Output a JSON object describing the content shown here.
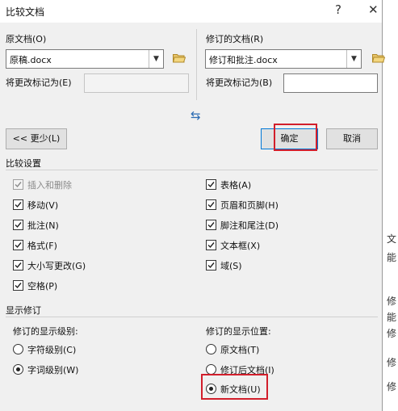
{
  "dialog": {
    "title": "比较文档",
    "help_icon": "?",
    "close_icon": "✕"
  },
  "original": {
    "label": "原文档(O)",
    "value": "原稿.docx",
    "mark_label": "将更改标记为(E)",
    "mark_value": ""
  },
  "revised": {
    "label": "修订的文档(R)",
    "value": "修订和批注.docx",
    "mark_label": "将更改标记为(B)",
    "mark_value": ""
  },
  "swap_icon": "⇆",
  "buttons": {
    "less": "<< 更少(L)",
    "ok": "确定",
    "cancel": "取消"
  },
  "compare_settings": {
    "title": "比较设置",
    "left": [
      {
        "label": "插入和删除",
        "checked": true,
        "disabled": true
      },
      {
        "label": "移动(V)",
        "checked": true,
        "disabled": false
      },
      {
        "label": "批注(N)",
        "checked": true,
        "disabled": false
      },
      {
        "label": "格式(F)",
        "checked": true,
        "disabled": false
      },
      {
        "label": "大小写更改(G)",
        "checked": true,
        "disabled": false
      },
      {
        "label": "空格(P)",
        "checked": true,
        "disabled": false
      }
    ],
    "right": [
      {
        "label": "表格(A)",
        "checked": true,
        "disabled": false
      },
      {
        "label": "页眉和页脚(H)",
        "checked": true,
        "disabled": false
      },
      {
        "label": "脚注和尾注(D)",
        "checked": true,
        "disabled": false
      },
      {
        "label": "文本框(X)",
        "checked": true,
        "disabled": false
      },
      {
        "label": "域(S)",
        "checked": true,
        "disabled": false
      }
    ]
  },
  "show_changes": {
    "title": "显示修订",
    "level_title": "修订的显示级别:",
    "level_options": [
      {
        "label": "字符级别(C)",
        "selected": false
      },
      {
        "label": "字词级别(W)",
        "selected": true
      }
    ],
    "location_title": "修订的显示位置:",
    "location_options": [
      {
        "label": "原文档(T)",
        "selected": false
      },
      {
        "label": "修订后文档(I)",
        "selected": false
      },
      {
        "label": "新文档(U)",
        "selected": true
      }
    ]
  },
  "background_chars": [
    "文",
    "能",
    "修",
    "能",
    "修",
    "修",
    "修"
  ],
  "colors": {
    "highlight": "#d21e2b",
    "accent": "#0078d7"
  }
}
